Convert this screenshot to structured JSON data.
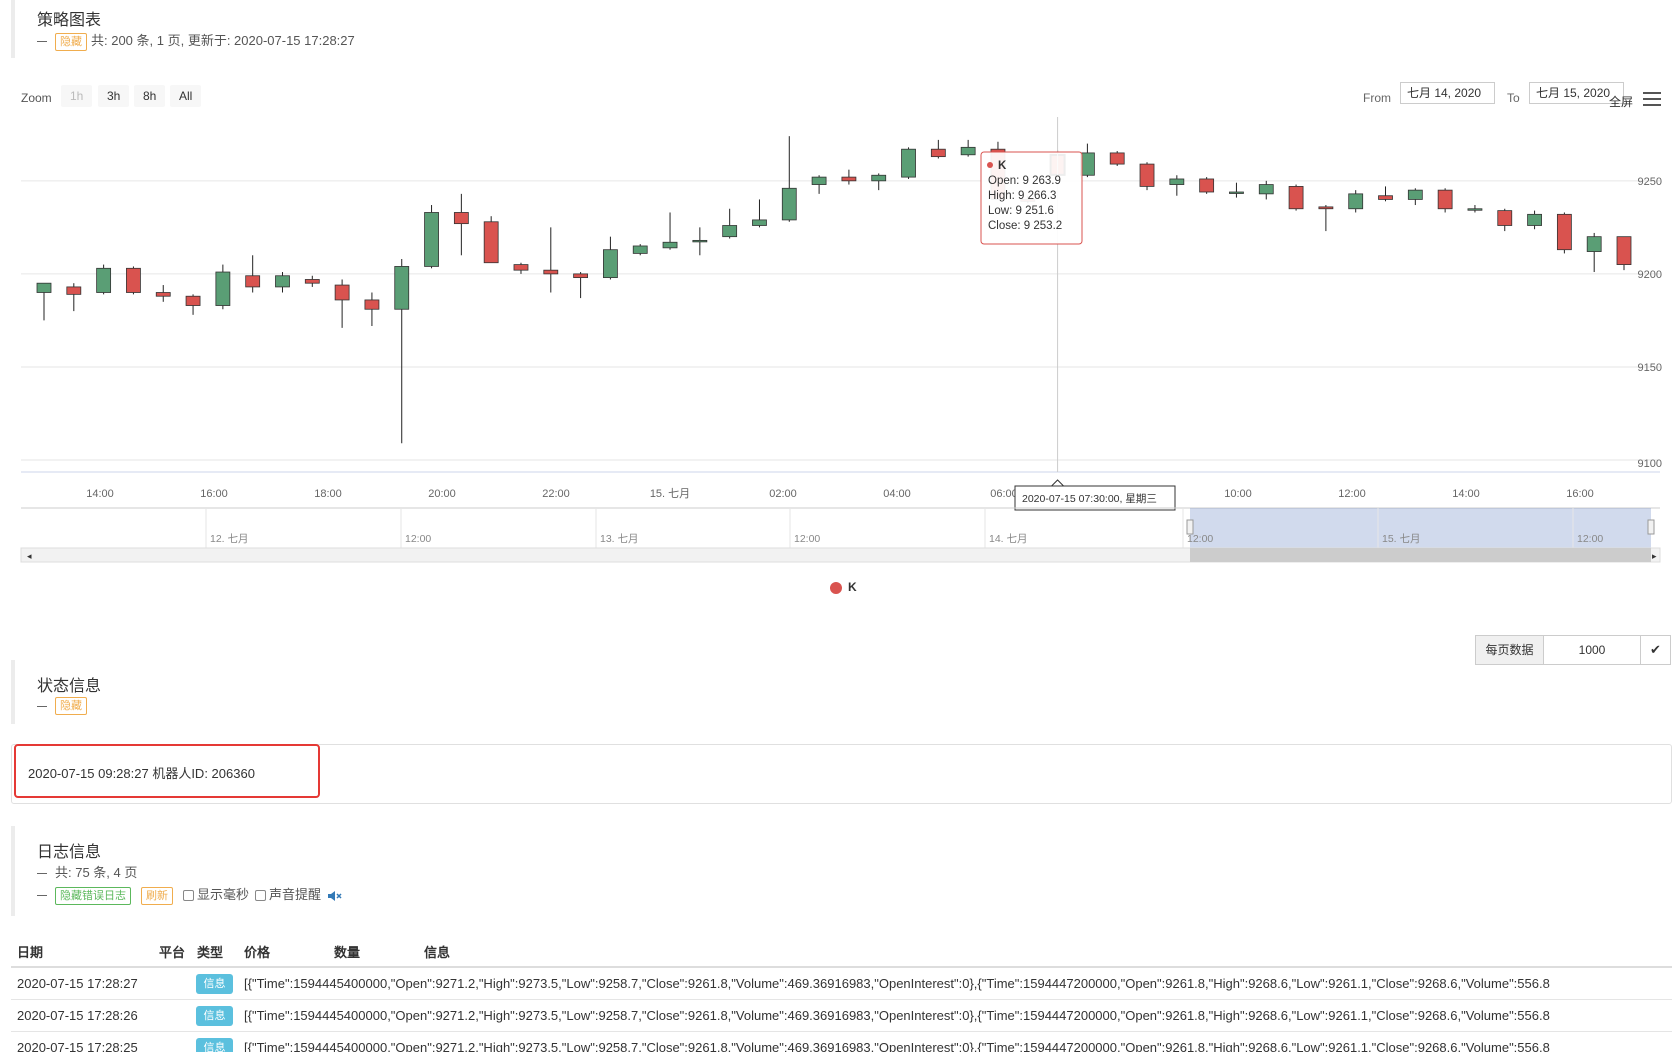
{
  "strategy_chart": {
    "title": "策略图表",
    "hide_label": "隐藏",
    "summary": "共: 200 条, 1 页, 更新于: 2020-07-15 17:28:27",
    "zoom_label": "Zoom",
    "zoom_buttons": [
      "1h",
      "3h",
      "8h",
      "All"
    ],
    "from_label": "From",
    "from_value": "七月 14, 2020",
    "to_label": "To",
    "to_value": "七月 15, 2020",
    "fullscreen_label": "全屏",
    "legend_label": "K",
    "tooltip": {
      "series": "K",
      "open": "Open: 9 263.9",
      "high": "High: 9 266.3",
      "low": "Low: 9 251.6",
      "close": "Close: 9 253.2"
    },
    "crosshair_label": "2020-07-15 07:30:00, 星期三"
  },
  "chart_data": {
    "type": "candlestick",
    "series_name": "K",
    "up_color": "#5a9e75",
    "down_color": "#d9534f",
    "ylim": [
      9100,
      9280
    ],
    "yticks": [
      9100,
      9150,
      9200,
      9250
    ],
    "xlabels": [
      "14:00",
      "16:00",
      "18:00",
      "20:00",
      "22:00",
      "15. 七月",
      "02:00",
      "04:00",
      "06:00",
      "10:00",
      "12:00",
      "14:00",
      "16:00"
    ],
    "x": [
      "12:30",
      "13:00",
      "13:30",
      "14:00",
      "14:30",
      "15:00",
      "15:30",
      "16:00",
      "16:30",
      "17:00",
      "17:30",
      "18:00",
      "18:30",
      "19:00",
      "19:30",
      "20:00",
      "20:30",
      "21:00",
      "21:30",
      "22:00",
      "22:30",
      "23:00",
      "23:30",
      "00:00",
      "00:30",
      "01:00",
      "01:30",
      "02:00",
      "02:30",
      "03:00",
      "03:30",
      "04:00",
      "04:30",
      "05:00",
      "05:30",
      "06:00",
      "06:30",
      "07:00",
      "07:30",
      "08:00",
      "08:30",
      "09:00",
      "09:30",
      "10:00",
      "10:30",
      "11:00",
      "11:30",
      "12:00",
      "12:30",
      "13:00",
      "13:30",
      "14:00",
      "14:30",
      "15:00",
      "15:30",
      "16:00",
      "16:30",
      "17:00"
    ],
    "candles": [
      {
        "o": 9190,
        "h": 9193,
        "l": 9175,
        "c": 9195
      },
      {
        "o": 9193,
        "h": 9195,
        "l": 9180,
        "c": 9189
      },
      {
        "o": 9190,
        "h": 9205,
        "l": 9189,
        "c": 9203
      },
      {
        "o": 9203,
        "h": 9204,
        "l": 9189,
        "c": 9190
      },
      {
        "o": 9190,
        "h": 9194,
        "l": 9185,
        "c": 9188
      },
      {
        "o": 9188,
        "h": 9189,
        "l": 9178,
        "c": 9183
      },
      {
        "o": 9183,
        "h": 9205,
        "l": 9181,
        "c": 9201
      },
      {
        "o": 9199,
        "h": 9210,
        "l": 9190,
        "c": 9193
      },
      {
        "o": 9193,
        "h": 9201,
        "l": 9190,
        "c": 9199
      },
      {
        "o": 9197,
        "h": 9199,
        "l": 9193,
        "c": 9195
      },
      {
        "o": 9194,
        "h": 9197,
        "l": 9171,
        "c": 9186
      },
      {
        "o": 9186,
        "h": 9190,
        "l": 9172,
        "c": 9181
      },
      {
        "o": 9181,
        "h": 9208,
        "l": 9109,
        "c": 9204
      },
      {
        "o": 9204,
        "h": 9237,
        "l": 9203,
        "c": 9233
      },
      {
        "o": 9233,
        "h": 9243,
        "l": 9210,
        "c": 9227
      },
      {
        "o": 9228,
        "h": 9231,
        "l": 9206,
        "c": 9206
      },
      {
        "o": 9205,
        "h": 9206,
        "l": 9200,
        "c": 9202
      },
      {
        "o": 9202,
        "h": 9225,
        "l": 9190,
        "c": 9200
      },
      {
        "o": 9200,
        "h": 9201,
        "l": 9187,
        "c": 9198
      },
      {
        "o": 9198,
        "h": 9220,
        "l": 9197,
        "c": 9213
      },
      {
        "o": 9211,
        "h": 9216,
        "l": 9210,
        "c": 9215
      },
      {
        "o": 9214,
        "h": 9233,
        "l": 9213,
        "c": 9217
      },
      {
        "o": 9218,
        "h": 9225,
        "l": 9210,
        "c": 9218
      },
      {
        "o": 9220,
        "h": 9235,
        "l": 9219,
        "c": 9226
      },
      {
        "o": 9226,
        "h": 9240,
        "l": 9225,
        "c": 9229
      },
      {
        "o": 9229,
        "h": 9274,
        "l": 9228,
        "c": 9246
      },
      {
        "o": 9248,
        "h": 9253,
        "l": 9243,
        "c": 9252
      },
      {
        "o": 9252,
        "h": 9256,
        "l": 9248,
        "c": 9250
      },
      {
        "o": 9250,
        "h": 9254,
        "l": 9245,
        "c": 9253
      },
      {
        "o": 9252,
        "h": 9268,
        "l": 9251,
        "c": 9267
      },
      {
        "o": 9267,
        "h": 9272,
        "l": 9262,
        "c": 9263
      },
      {
        "o": 9264,
        "h": 9272,
        "l": 9263,
        "c": 9268
      },
      {
        "o": 9267,
        "h": 9271,
        "l": 9240,
        "c": 9240
      },
      {
        "o": 9240,
        "h": 9242,
        "l": 9238,
        "c": 9239
      },
      {
        "o": 9263.9,
        "h": 9266.3,
        "l": 9251.6,
        "c": 9253.2
      },
      {
        "o": 9253,
        "h": 9270,
        "l": 9252,
        "c": 9265
      },
      {
        "o": 9265,
        "h": 9266,
        "l": 9258,
        "c": 9259
      },
      {
        "o": 9259,
        "h": 9260,
        "l": 9245,
        "c": 9247
      },
      {
        "o": 9248,
        "h": 9253,
        "l": 9242,
        "c": 9251
      },
      {
        "o": 9251,
        "h": 9252,
        "l": 9243,
        "c": 9244
      },
      {
        "o": 9244,
        "h": 9249,
        "l": 9241,
        "c": 9244
      },
      {
        "o": 9243,
        "h": 9250,
        "l": 9240,
        "c": 9248
      },
      {
        "o": 9247,
        "h": 9248,
        "l": 9234,
        "c": 9235
      },
      {
        "o": 9236,
        "h": 9237,
        "l": 9223,
        "c": 9235
      },
      {
        "o": 9235,
        "h": 9245,
        "l": 9233,
        "c": 9243
      },
      {
        "o": 9242,
        "h": 9247,
        "l": 9239,
        "c": 9240
      },
      {
        "o": 9240,
        "h": 9246,
        "l": 9237,
        "c": 9245
      },
      {
        "o": 9245,
        "h": 9246,
        "l": 9233,
        "c": 9235
      },
      {
        "o": 9235,
        "h": 9237,
        "l": 9233,
        "c": 9235
      },
      {
        "o": 9234,
        "h": 9235,
        "l": 9223,
        "c": 9226
      },
      {
        "o": 9226,
        "h": 9234,
        "l": 9224,
        "c": 9232
      },
      {
        "o": 9232,
        "h": 9233,
        "l": 9211,
        "c": 9213
      },
      {
        "o": 9212,
        "h": 9222,
        "l": 9201,
        "c": 9220
      },
      {
        "o": 9220,
        "h": 9220,
        "l": 9202,
        "c": 9205
      }
    ],
    "navigator_labels": [
      "12. 七月",
      "12:00",
      "13. 七月",
      "12:00",
      "14. 七月",
      "12:00",
      "15. 七月",
      "12:00"
    ]
  },
  "page_size": {
    "label": "每页数据",
    "value": "1000"
  },
  "status_info": {
    "title": "状态信息",
    "hide_label": "隐藏",
    "content": "2020-07-15 09:28:27 机器人ID:   206360"
  },
  "log_info": {
    "title": "日志信息",
    "summary": "共: 75 条, 4 页",
    "hide_error_label": "隐藏错误日志",
    "refresh_label": "刷新",
    "show_ms_label": "显示毫秒",
    "sound_label": "声音提醒",
    "columns": [
      "日期",
      "平台",
      "类型",
      "价格",
      "数量",
      "信息"
    ],
    "rows": [
      {
        "date": "2020-07-15 17:28:27",
        "type": "信息",
        "message": "[{\"Time\":1594445400000,\"Open\":9271.2,\"High\":9273.5,\"Low\":9258.7,\"Close\":9261.8,\"Volume\":469.36916983,\"OpenInterest\":0},{\"Time\":1594447200000,\"Open\":9261.8,\"High\":9268.6,\"Low\":9261.1,\"Close\":9268.6,\"Volume\":556.8"
      },
      {
        "date": "2020-07-15 17:28:26",
        "type": "信息",
        "message": "[{\"Time\":1594445400000,\"Open\":9271.2,\"High\":9273.5,\"Low\":9258.7,\"Close\":9261.8,\"Volume\":469.36916983,\"OpenInterest\":0},{\"Time\":1594447200000,\"Open\":9261.8,\"High\":9268.6,\"Low\":9261.1,\"Close\":9268.6,\"Volume\":556.8"
      },
      {
        "date": "2020-07-15 17:28:25",
        "type": "信息",
        "message": "[{\"Time\":1594445400000,\"Open\":9271.2,\"High\":9273.5,\"Low\":9258.7,\"Close\":9261.8,\"Volume\":469.36916983,\"OpenInterest\":0},{\"Time\":1594447200000,\"Open\":9261.8,\"High\":9268.6,\"Low\":9261.1,\"Close\":9268.6,\"Volume\":556.8"
      }
    ]
  }
}
